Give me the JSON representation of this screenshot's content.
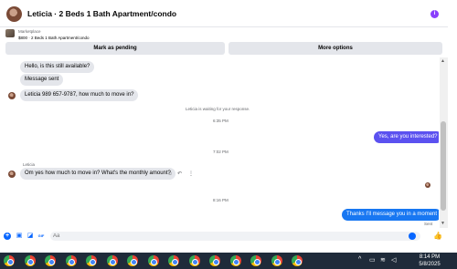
{
  "header": {
    "title": "Leticia · 2 Beds 1 Bath Apartment/condo",
    "info_icon": "info-icon"
  },
  "listing": {
    "type": "Marketplace",
    "price_title": "$800 · 2 Beds 1 Bath Apartment/condo"
  },
  "actions": {
    "pending_label": "Mark as pending",
    "more_label": "More options"
  },
  "messages": {
    "msg1": "Hello, is this still available?",
    "msg2": "Message sent",
    "msg3": "Leticia 989 657-9787,  how much to move in?",
    "waiting": "Leticia is waiting for your response.",
    "time1": "6:35 PM",
    "reply1": "Yes, are you interested?",
    "time2": "7:02 PM",
    "sender": "Leticia",
    "msg4": "Om yes how much to move in? What's the monthly amount?",
    "time3": "8:16 PM",
    "reply2": "Thanks I’ll message you in a moment",
    "status": "Sent"
  },
  "composer": {
    "placeholder": "Aa"
  },
  "taskbar": {
    "time": "8:14 PM",
    "date": "5/8/2025",
    "app_count": 15
  },
  "colors": {
    "accent": "#0866ff",
    "outgoing_purple": "#5b51f0",
    "outgoing_blue": "#1877f2",
    "incoming": "#e4e6eb"
  }
}
